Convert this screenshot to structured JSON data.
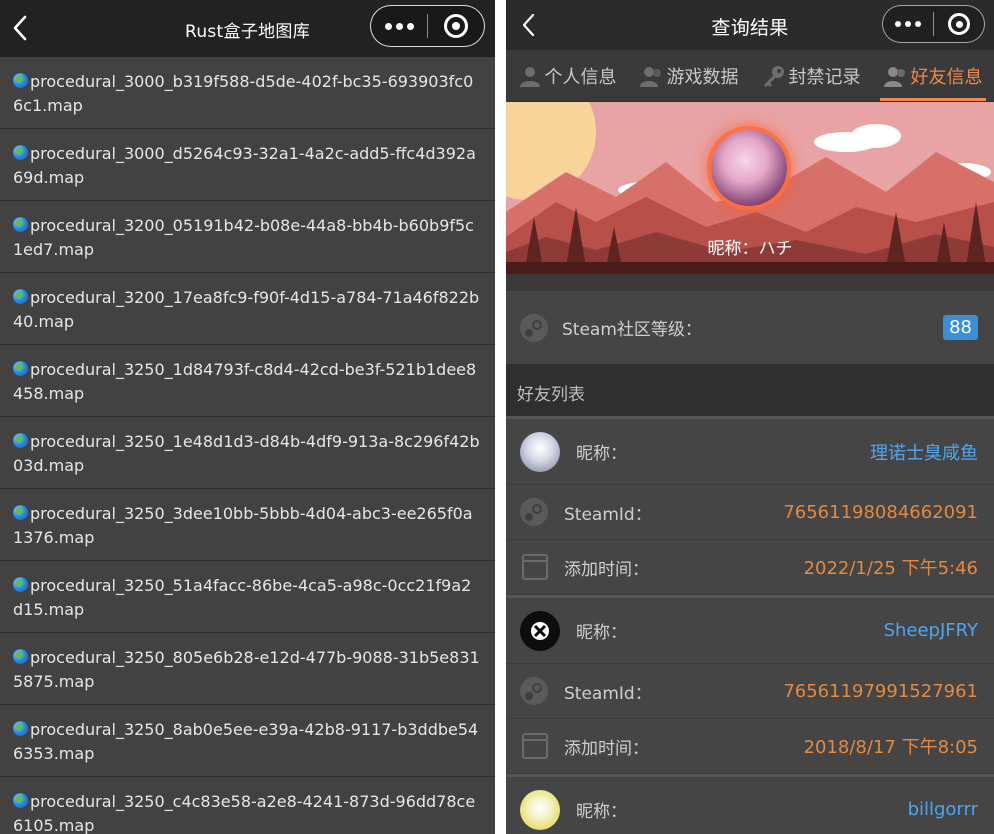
{
  "left_panel": {
    "title": "Rust盒子地图库",
    "maps": [
      "procedural_3000_b319f588-d5de-402f-bc35-693903fc06c1.map",
      "procedural_3000_d5264c93-32a1-4a2c-add5-ffc4d392a69d.map",
      "procedural_3200_05191b42-b08e-44a8-bb4b-b60b9f5c1ed7.map",
      "procedural_3200_17ea8fc9-f90f-4d15-a784-71a46f822b40.map",
      "procedural_3250_1d84793f-c8d4-42cd-be3f-521b1dee8458.map",
      "procedural_3250_1e48d1d3-d84b-4df9-913a-8c296f42b03d.map",
      "procedural_3250_3dee10bb-5bbb-4d04-abc3-ee265f0a1376.map",
      "procedural_3250_51a4facc-86be-4ca5-a98c-0cc21f9a2d15.map",
      "procedural_3250_805e6b28-e12d-477b-9088-31b5e8315875.map",
      "procedural_3250_8ab0e5ee-e39a-42b8-9117-b3ddbe546353.map",
      "procedural_3250_c4c83e58-a2e8-4241-873d-96dd78ce6105.map"
    ]
  },
  "right_panel": {
    "title": "查询结果",
    "tabs": [
      {
        "label": "个人信息",
        "icon": "person-icon",
        "active": false
      },
      {
        "label": "游戏数据",
        "icon": "people-icon",
        "active": false
      },
      {
        "label": "封禁记录",
        "icon": "key-icon",
        "active": false
      },
      {
        "label": "好友信息",
        "icon": "friends-icon",
        "active": true
      }
    ],
    "profile": {
      "nickname_label": "昵称：",
      "nickname": "ハチ"
    },
    "steam_level": {
      "label": "Steam社区等级：",
      "value": "88"
    },
    "friends_header": "好友列表",
    "friends": [
      {
        "nickname_label": "昵称：",
        "nickname": "理诺士臭咸鱼",
        "steamid_label": "SteamId：",
        "steamid": "76561198084662091",
        "added_label": "添加时间：",
        "added": "2022/1/25 下午5:46"
      },
      {
        "nickname_label": "昵称：",
        "nickname": "SheepJFRY",
        "steamid_label": "SteamId：",
        "steamid": "76561197991527961",
        "added_label": "添加时间：",
        "added": "2018/8/17 下午8:05"
      },
      {
        "nickname_label": "昵称：",
        "nickname": "billgorrr"
      }
    ]
  },
  "colors": {
    "accent_orange": "#f08a4b",
    "value_blue": "#4ea6ef",
    "value_orange": "#e38a3f",
    "badge_blue": "#3b8fd9"
  }
}
